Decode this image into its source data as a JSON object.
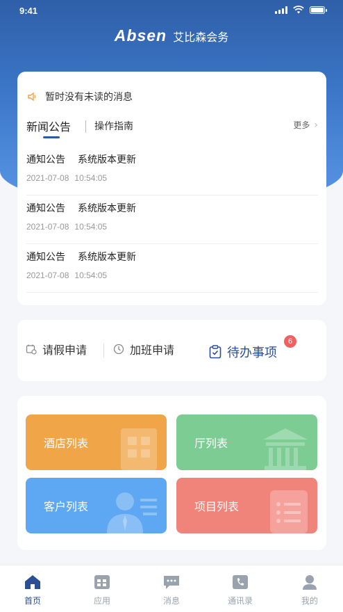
{
  "status_bar": {
    "time": "9:41"
  },
  "brand": {
    "logo": "Absen",
    "name": "艾比森会务"
  },
  "notice": {
    "text": "暂时没有未读的消息"
  },
  "tabs": {
    "news": "新闻公告",
    "guide": "操作指南",
    "more": "更多"
  },
  "news": [
    {
      "category": "通知公告",
      "title": "系统版本更新",
      "date": "2021-07-08",
      "time": "10:54:05"
    },
    {
      "category": "通知公告",
      "title": "系统版本更新",
      "date": "2021-07-08",
      "time": "10:54:05"
    },
    {
      "category": "通知公告",
      "title": "系统版本更新",
      "date": "2021-07-08",
      "time": "10:54:05"
    }
  ],
  "actions": {
    "leave": "请假申请",
    "overtime": "加班申请",
    "todo": "待办事项",
    "todo_badge": "6"
  },
  "tiles": {
    "hotel": "酒店列表",
    "hall": "厅列表",
    "customer": "客户列表",
    "project": "项目列表"
  },
  "tabbar": {
    "home": "首页",
    "apps": "应用",
    "messages": "消息",
    "contacts": "通讯录",
    "mine": "我的"
  },
  "colors": {
    "primary": "#2b4f93",
    "hotel": "#f0a648",
    "hall": "#7ccc94",
    "customer": "#5ea7f2",
    "project": "#f0837a",
    "badge": "#f06060"
  }
}
